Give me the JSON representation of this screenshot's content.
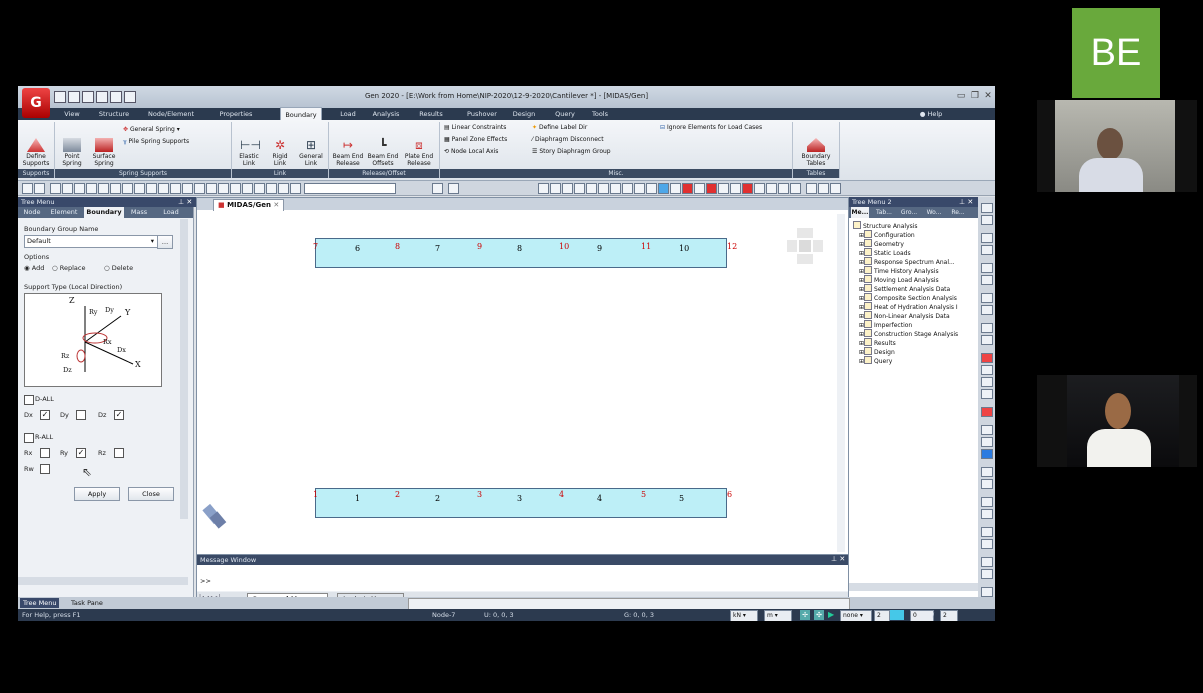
{
  "app": {
    "logo_text": "G",
    "window_title": "Gen 2020 - [E:\\Work from Home\\NIP-2020\\12-9-2020\\Cantilever *] - [MIDAS/Gen]",
    "help_label": "Help"
  },
  "menu_tabs": [
    "View",
    "Structure",
    "Node/Element",
    "Properties",
    "Boundary",
    "Load",
    "Analysis",
    "Results",
    "Pushover",
    "Design",
    "Query",
    "Tools"
  ],
  "ribbon": {
    "supports": {
      "define": "Define\nSupports",
      "label": "Supports"
    },
    "spring": {
      "point": "Point\nSpring",
      "surface": "Surface\nSpring",
      "general_spring": "General Spring",
      "pile": "Pile Spring Supports",
      "label": "Spring Supports"
    },
    "link": {
      "elastic": "Elastic\nLink",
      "rigid": "Rigid\nLink",
      "general": "General\nLink",
      "label": "Link"
    },
    "release": {
      "beam_end": "Beam End\nRelease",
      "beam_offsets": "Beam End\nOffsets",
      "plate_end": "Plate End\nRelease",
      "label": "Release/Offset"
    },
    "misc": {
      "linear": "Linear Constraints",
      "define_label": "Define Label Dir",
      "ignore": "Ignore Elements for Load Cases",
      "panel": "Panel Zone Effects",
      "diaphragm": "Diaphragm Disconnect",
      "node_local": "Node Local Axis",
      "story": "Story Diaphragm Group",
      "label": "Misc."
    },
    "tables": {
      "boundary": "Boundary\nTables",
      "label": "Tables"
    }
  },
  "left_panel": {
    "title": "Tree Menu",
    "tabs": [
      "Node",
      "Element",
      "Boundary",
      "Mass",
      "Load"
    ],
    "active_tab": "Boundary",
    "group_name_label": "Boundary Group Name",
    "group_name_value": "Default",
    "options_label": "Options",
    "opt_add": "Add",
    "opt_replace": "Replace",
    "opt_delete": "Delete",
    "support_type_label": "Support Type (Local Direction)",
    "diagram": {
      "z": "Z",
      "y": "Y",
      "x": "X",
      "ry": "Ry",
      "dy": "Dy",
      "rx": "Rx",
      "dx": "Dx",
      "rz": "Rz",
      "dz": "Dz"
    },
    "d_all": "D-ALL",
    "dx": "Dx",
    "dy": "Dy",
    "dz": "Dz",
    "r_all": "R-ALL",
    "rx": "Rx",
    "ry": "Ry",
    "rz": "Rz",
    "rw": "Rw",
    "apply": "Apply",
    "close": "Close"
  },
  "doc_tab": "MIDAS/Gen",
  "model": {
    "top_nodes": [
      "7",
      "8",
      "9",
      "10",
      "11",
      "12"
    ],
    "top_elems": [
      "6",
      "7",
      "8",
      "9",
      "10"
    ],
    "bottom_nodes": [
      "1",
      "2",
      "3",
      "4",
      "5",
      "6"
    ],
    "bottom_elems": [
      "1",
      "2",
      "3",
      "4",
      "5"
    ]
  },
  "message_window": {
    "title": "Message Window",
    "prompt": ">>",
    "tab_command": "Command Message",
    "tab_analysis": "Analysis Message"
  },
  "right_panel": {
    "title": "Tree Menu 2",
    "tabs": [
      "Me...",
      "Tab...",
      "Gro...",
      "Wo...",
      "Re..."
    ],
    "items": [
      "Structure Analysis",
      "Configuration",
      "Geometry",
      "Static Loads",
      "Response Spectrum Anal...",
      "Time History Analysis",
      "Moving Load Analysis",
      "Settlement Analysis Data",
      "Composite Section Analysis",
      "Heat of Hydration Analysis I",
      "Non-Linear Analysis Data",
      "Imperfection",
      "Construction Stage Analysis",
      "Results",
      "Design",
      "Query"
    ]
  },
  "bottom_tabs": {
    "tree_menu": "Tree Menu",
    "task_pane": "Task Pane"
  },
  "status": {
    "help": "For Help, press F1",
    "node": "Node-7",
    "u": "U: 0, 0, 3",
    "g": "G: 0, 0, 3",
    "unit_force": "kN",
    "unit_length": "m",
    "none": "none",
    "n1": "2",
    "n2": "0",
    "n3": "2"
  },
  "participants": {
    "initials": "BE",
    "avatar_color": "#69a93c"
  }
}
